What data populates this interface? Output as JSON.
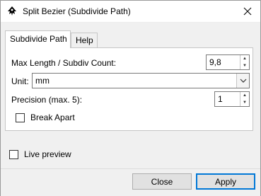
{
  "window": {
    "title": "Split Bezier (Subdivide Path)"
  },
  "tabs": [
    {
      "label": "Subdivide Path",
      "active": true
    },
    {
      "label": "Help",
      "active": false
    }
  ],
  "fields": {
    "max_length_label": "Max Length / Subdiv Count:",
    "max_length_value": "9,8",
    "unit_label": "Unit:",
    "unit_value": "mm",
    "precision_label": "Precision (max. 5):",
    "precision_value": "1",
    "break_apart_label": "Break Apart",
    "break_apart_checked": false
  },
  "live_preview": {
    "label": "Live preview",
    "checked": false
  },
  "buttons": {
    "close_first": "C",
    "close_rest": "lose",
    "apply_first": "A",
    "apply_rest": "pply"
  },
  "icons": {
    "app": "inkscape-icon",
    "close": "close-icon",
    "spin_up": "spin-up-icon",
    "spin_down": "spin-down-icon",
    "dropdown": "chevron-down-icon"
  }
}
